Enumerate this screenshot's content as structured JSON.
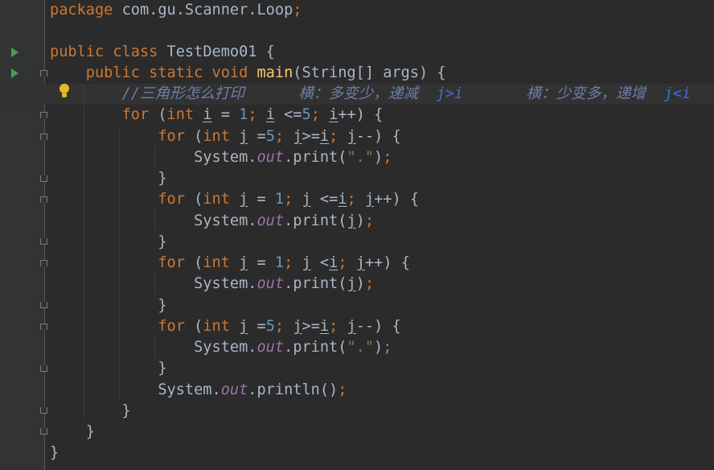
{
  "editor": {
    "colors": {
      "background": "#2b2b2b",
      "gutter": "#313335",
      "keyword": "#cc7832",
      "number": "#6897bb",
      "string": "#6a8759",
      "method_declaration": "#ffc66d",
      "static_field": "#9876aa",
      "comment": "#6d7ea8",
      "default_text": "#a9b7c6"
    },
    "gutter_icons": {
      "run": "run-arrow-icon",
      "fold": "fold-marker-icon",
      "intention": "lightbulb-icon"
    },
    "lines": [
      [
        [
          "kw",
          "package"
        ],
        [
          "p",
          " com.gu.Scanner.Loop"
        ],
        [
          "kw",
          ";"
        ]
      ],
      [],
      [
        [
          "kw",
          "public class"
        ],
        [
          "p",
          " TestDemo01 {"
        ]
      ],
      [
        [
          "p",
          "    "
        ],
        [
          "kw",
          "public static void"
        ],
        [
          "p",
          " "
        ],
        [
          "fn",
          "main"
        ],
        [
          "p",
          "(String[] args) {"
        ]
      ],
      [
        [
          "p",
          "        "
        ],
        [
          "cm",
          "//三角形怎么打印      横：多变少，递减  "
        ],
        [
          "cmj",
          "j>i"
        ],
        [
          "cm",
          "       横：少变多，递增  "
        ],
        [
          "cmj",
          "j<i"
        ]
      ],
      [
        [
          "p",
          "        "
        ],
        [
          "kw",
          "for"
        ],
        [
          "p",
          " ("
        ],
        [
          "kw",
          "int"
        ],
        [
          "p",
          " "
        ],
        [
          "u",
          "i"
        ],
        [
          "p",
          " = "
        ],
        [
          "num",
          "1"
        ],
        [
          "kw",
          ";"
        ],
        [
          "p",
          " "
        ],
        [
          "u",
          "i"
        ],
        [
          "p",
          " <="
        ],
        [
          "num",
          "5"
        ],
        [
          "kw",
          ";"
        ],
        [
          "p",
          " "
        ],
        [
          "u",
          "i"
        ],
        [
          "p",
          "++) {"
        ]
      ],
      [
        [
          "p",
          "            "
        ],
        [
          "kw",
          "for"
        ],
        [
          "p",
          " ("
        ],
        [
          "kw",
          "int"
        ],
        [
          "p",
          " "
        ],
        [
          "u",
          "j"
        ],
        [
          "p",
          " ="
        ],
        [
          "num",
          "5"
        ],
        [
          "kw",
          ";"
        ],
        [
          "p",
          " "
        ],
        [
          "u",
          "j"
        ],
        [
          "p",
          ">="
        ],
        [
          "u",
          "i"
        ],
        [
          "kw",
          ";"
        ],
        [
          "p",
          " "
        ],
        [
          "u",
          "j"
        ],
        [
          "p",
          "--) {"
        ]
      ],
      [
        [
          "p",
          "                System."
        ],
        [
          "fld",
          "out"
        ],
        [
          "p",
          ".print("
        ],
        [
          "str",
          "\".\""
        ],
        [
          "p",
          ")"
        ],
        [
          "kw",
          ";"
        ]
      ],
      [
        [
          "p",
          "            }"
        ]
      ],
      [
        [
          "p",
          "            "
        ],
        [
          "kw",
          "for"
        ],
        [
          "p",
          " ("
        ],
        [
          "kw",
          "int"
        ],
        [
          "p",
          " "
        ],
        [
          "u",
          "j"
        ],
        [
          "p",
          " = "
        ],
        [
          "num",
          "1"
        ],
        [
          "kw",
          ";"
        ],
        [
          "p",
          " "
        ],
        [
          "u",
          "j"
        ],
        [
          "p",
          " <="
        ],
        [
          "u",
          "i"
        ],
        [
          "kw",
          ";"
        ],
        [
          "p",
          " "
        ],
        [
          "u",
          "j"
        ],
        [
          "p",
          "++) {"
        ]
      ],
      [
        [
          "p",
          "                System."
        ],
        [
          "fld",
          "out"
        ],
        [
          "p",
          ".print("
        ],
        [
          "u",
          "j"
        ],
        [
          "p",
          ")"
        ],
        [
          "kw",
          ";"
        ]
      ],
      [
        [
          "p",
          "            }"
        ]
      ],
      [
        [
          "p",
          "            "
        ],
        [
          "kw",
          "for"
        ],
        [
          "p",
          " ("
        ],
        [
          "kw",
          "int"
        ],
        [
          "p",
          " "
        ],
        [
          "u",
          "j"
        ],
        [
          "p",
          " = "
        ],
        [
          "num",
          "1"
        ],
        [
          "kw",
          ";"
        ],
        [
          "p",
          " "
        ],
        [
          "u",
          "j"
        ],
        [
          "p",
          " <"
        ],
        [
          "u",
          "i"
        ],
        [
          "kw",
          ";"
        ],
        [
          "p",
          " "
        ],
        [
          "u",
          "j"
        ],
        [
          "p",
          "++) {"
        ]
      ],
      [
        [
          "p",
          "                System."
        ],
        [
          "fld",
          "out"
        ],
        [
          "p",
          ".print("
        ],
        [
          "u",
          "j"
        ],
        [
          "p",
          ")"
        ],
        [
          "kw",
          ";"
        ]
      ],
      [
        [
          "p",
          "            }"
        ]
      ],
      [
        [
          "p",
          "            "
        ],
        [
          "kw",
          "for"
        ],
        [
          "p",
          " ("
        ],
        [
          "kw",
          "int"
        ],
        [
          "p",
          " "
        ],
        [
          "u",
          "j"
        ],
        [
          "p",
          " ="
        ],
        [
          "num",
          "5"
        ],
        [
          "kw",
          ";"
        ],
        [
          "p",
          " "
        ],
        [
          "u",
          "j"
        ],
        [
          "p",
          ">="
        ],
        [
          "u",
          "i"
        ],
        [
          "kw",
          ";"
        ],
        [
          "p",
          " "
        ],
        [
          "u",
          "j"
        ],
        [
          "p",
          "--) {"
        ]
      ],
      [
        [
          "p",
          "                System."
        ],
        [
          "fld",
          "out"
        ],
        [
          "p",
          ".print("
        ],
        [
          "str",
          "\".\""
        ],
        [
          "p",
          ")"
        ],
        [
          "kw",
          ";"
        ]
      ],
      [
        [
          "p",
          "            }"
        ]
      ],
      [
        [
          "p",
          "            System."
        ],
        [
          "fld",
          "out"
        ],
        [
          "p",
          ".println()"
        ],
        [
          "kw",
          ";"
        ]
      ],
      [
        [
          "p",
          "        }"
        ]
      ],
      [
        [
          "p",
          "    }"
        ]
      ],
      [
        [
          "p",
          "}"
        ]
      ]
    ]
  }
}
